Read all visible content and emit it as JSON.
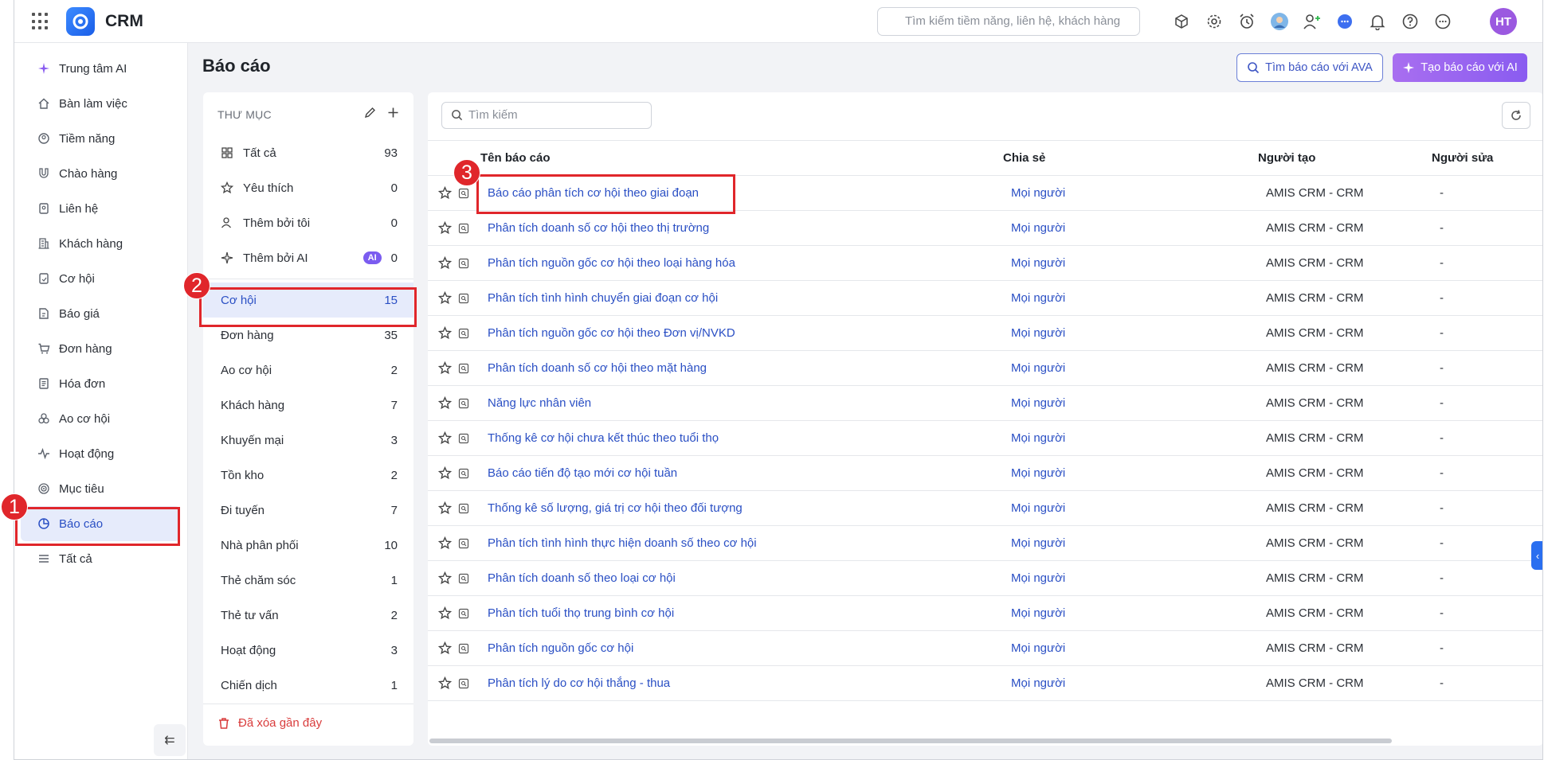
{
  "app": {
    "name": "CRM",
    "search_placeholder": "Tìm kiếm tiềm năng, liên hệ, khách hàng",
    "avatar_initials": "HT"
  },
  "sidebar": {
    "items": [
      {
        "label": "Trung tâm AI",
        "icon": "sparkle-icon"
      },
      {
        "label": "Bàn làm việc",
        "icon": "home-icon"
      },
      {
        "label": "Tiềm năng",
        "icon": "prospect-icon"
      },
      {
        "label": "Chào hàng",
        "icon": "magnet-icon"
      },
      {
        "label": "Liên hệ",
        "icon": "contact-icon"
      },
      {
        "label": "Khách hàng",
        "icon": "building-icon"
      },
      {
        "label": "Cơ hội",
        "icon": "opportunity-icon"
      },
      {
        "label": "Báo giá",
        "icon": "quote-icon"
      },
      {
        "label": "Đơn hàng",
        "icon": "cart-icon"
      },
      {
        "label": "Hóa đơn",
        "icon": "invoice-icon"
      },
      {
        "label": "Ao cơ hội",
        "icon": "pool-icon"
      },
      {
        "label": "Hoạt động",
        "icon": "activity-icon"
      },
      {
        "label": "Mục tiêu",
        "icon": "target-icon"
      },
      {
        "label": "Báo cáo",
        "icon": "report-icon"
      },
      {
        "label": "Tất cả",
        "icon": "menu-icon"
      }
    ],
    "active_index": 13
  },
  "page": {
    "title": "Báo cáo",
    "btn_ava": "Tìm báo cáo với AVA",
    "btn_ai": "Tạo báo cáo với AI"
  },
  "folders": {
    "heading": "THƯ MỤC",
    "top": [
      {
        "label": "Tất cả",
        "count": "93"
      },
      {
        "label": "Yêu thích",
        "count": "0"
      },
      {
        "label": "Thêm bởi tôi",
        "count": "0"
      },
      {
        "label": "Thêm bởi AI",
        "count": "0",
        "badge": "AI"
      }
    ],
    "list": [
      {
        "label": "Cơ hội",
        "count": "15"
      },
      {
        "label": "Đơn hàng",
        "count": "35"
      },
      {
        "label": "Ao cơ hội",
        "count": "2"
      },
      {
        "label": "Khách hàng",
        "count": "7"
      },
      {
        "label": "Khuyến mại",
        "count": "3"
      },
      {
        "label": "Tồn kho",
        "count": "2"
      },
      {
        "label": "Đi tuyến",
        "count": "7"
      },
      {
        "label": "Nhà phân phối",
        "count": "10"
      },
      {
        "label": "Thẻ chăm sóc",
        "count": "1"
      },
      {
        "label": "Thẻ tư vấn",
        "count": "2"
      },
      {
        "label": "Hoạt động",
        "count": "3"
      },
      {
        "label": "Chiến dịch",
        "count": "1"
      }
    ],
    "trash": "Đã xóa gần đây"
  },
  "table": {
    "search_placeholder": "Tìm kiếm",
    "columns": [
      "Tên báo cáo",
      "Chia sẻ",
      "Người tạo",
      "Người sửa"
    ],
    "rows": [
      {
        "name": "Báo cáo phân tích cơ hội theo giai đoạn",
        "share": "Mọi người",
        "creator": "AMIS CRM - CRM",
        "editor": "-"
      },
      {
        "name": "Phân tích doanh số cơ hội theo thị trường",
        "share": "Mọi người",
        "creator": "AMIS CRM - CRM",
        "editor": "-"
      },
      {
        "name": "Phân tích nguồn gốc cơ hội theo loại hàng hóa",
        "share": "Mọi người",
        "creator": "AMIS CRM - CRM",
        "editor": "-"
      },
      {
        "name": "Phân tích tình hình chuyển giai đoạn cơ hội",
        "share": "Mọi người",
        "creator": "AMIS CRM - CRM",
        "editor": "-"
      },
      {
        "name": "Phân tích nguồn gốc cơ hội theo Đơn vị/NVKD",
        "share": "Mọi người",
        "creator": "AMIS CRM - CRM",
        "editor": "-"
      },
      {
        "name": "Phân tích doanh số cơ hội theo mặt hàng",
        "share": "Mọi người",
        "creator": "AMIS CRM - CRM",
        "editor": "-"
      },
      {
        "name": "Năng lực nhân viên",
        "share": "Mọi người",
        "creator": "AMIS CRM - CRM",
        "editor": "-"
      },
      {
        "name": "Thống kê cơ hội chưa kết thúc theo tuổi thọ",
        "share": "Mọi người",
        "creator": "AMIS CRM - CRM",
        "editor": "-"
      },
      {
        "name": "Báo cáo tiến độ tạo mới cơ hội tuần",
        "share": "Mọi người",
        "creator": "AMIS CRM - CRM",
        "editor": "-"
      },
      {
        "name": "Thống kê số lượng, giá trị cơ hội theo đối tượng",
        "share": "Mọi người",
        "creator": "AMIS CRM - CRM",
        "editor": "-"
      },
      {
        "name": "Phân tích tình hình thực hiện doanh số theo cơ hội",
        "share": "Mọi người",
        "creator": "AMIS CRM - CRM",
        "editor": "-"
      },
      {
        "name": "Phân tích doanh số theo loại cơ hội",
        "share": "Mọi người",
        "creator": "AMIS CRM - CRM",
        "editor": "-"
      },
      {
        "name": "Phân tích tuổi thọ trung bình cơ hội",
        "share": "Mọi người",
        "creator": "AMIS CRM - CRM",
        "editor": "-"
      },
      {
        "name": "Phân tích nguồn gốc cơ hội",
        "share": "Mọi người",
        "creator": "AMIS CRM - CRM",
        "editor": "-"
      },
      {
        "name": "Phân tích lý do cơ hội thắng - thua",
        "share": "Mọi người",
        "creator": "AMIS CRM - CRM",
        "editor": "-"
      }
    ]
  },
  "annotations": [
    "1",
    "2",
    "3"
  ],
  "colors": {
    "accent": "#2a4fc4",
    "highlight": "#e0262b",
    "ai_purple": "#8a5cf0"
  }
}
